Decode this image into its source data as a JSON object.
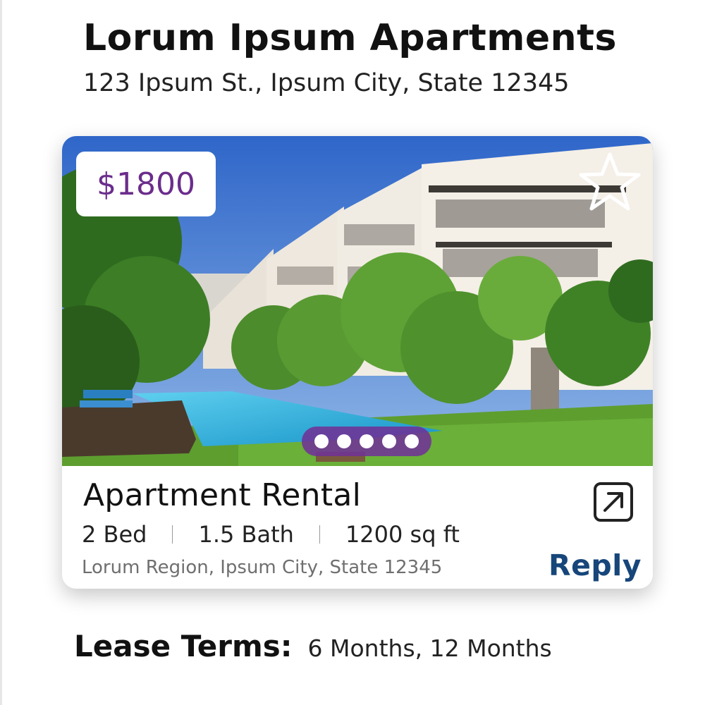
{
  "property": {
    "name": "Lorum Ipsum Apartments",
    "address": "123 Ipsum St., Ipsum City, State 12345"
  },
  "listing": {
    "price": "$1800",
    "type": "Apartment Rental",
    "beds": "2 Bed",
    "baths": "1.5 Bath",
    "area": "1200 sq ft",
    "location": "Lorum Region, Ipsum City, State 12345",
    "reply_label": "Reply",
    "photo_count": 5,
    "icons": {
      "favorite": "star-icon",
      "open": "external-link-icon"
    }
  },
  "lease_terms": {
    "label": "Lease Terms:",
    "value": "6 Months, 12 Months"
  },
  "colors": {
    "price": "#6b2d8c",
    "carousel_pill": "#703296",
    "reply": "#16467a"
  }
}
